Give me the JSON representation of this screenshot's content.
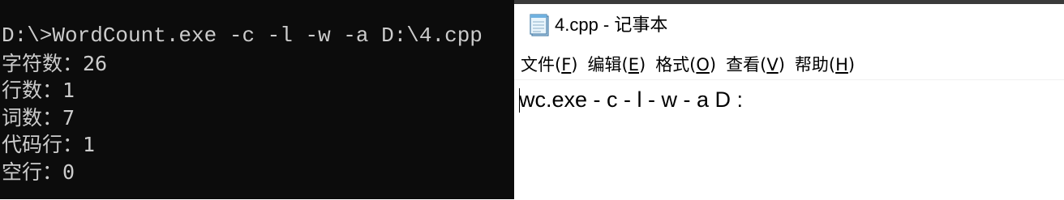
{
  "console": {
    "lines": [
      "D:\\>WordCount.exe -c -l -w -a D:\\4.cpp",
      "字符数：26",
      "行数：1",
      "词数：7",
      "代码行：1",
      "空行：0"
    ]
  },
  "notepad": {
    "title": "4.cpp - 记事本",
    "menu": [
      {
        "label": "文件(",
        "key": "F",
        "end": ")"
      },
      {
        "label": "编辑(",
        "key": "E",
        "end": ")"
      },
      {
        "label": "格式(",
        "key": "O",
        "end": ")"
      },
      {
        "label": "查看(",
        "key": "V",
        "end": ")"
      },
      {
        "label": "帮助(",
        "key": "H",
        "end": ")"
      }
    ],
    "content": "wc.exe - c - l - w - a D :"
  },
  "colors": {
    "console_bg": "#0c0c0c",
    "console_fg": "#cccccc",
    "notepad_bg": "#ffffff"
  },
  "icons": {
    "notepad_app": "notepad-icon"
  }
}
